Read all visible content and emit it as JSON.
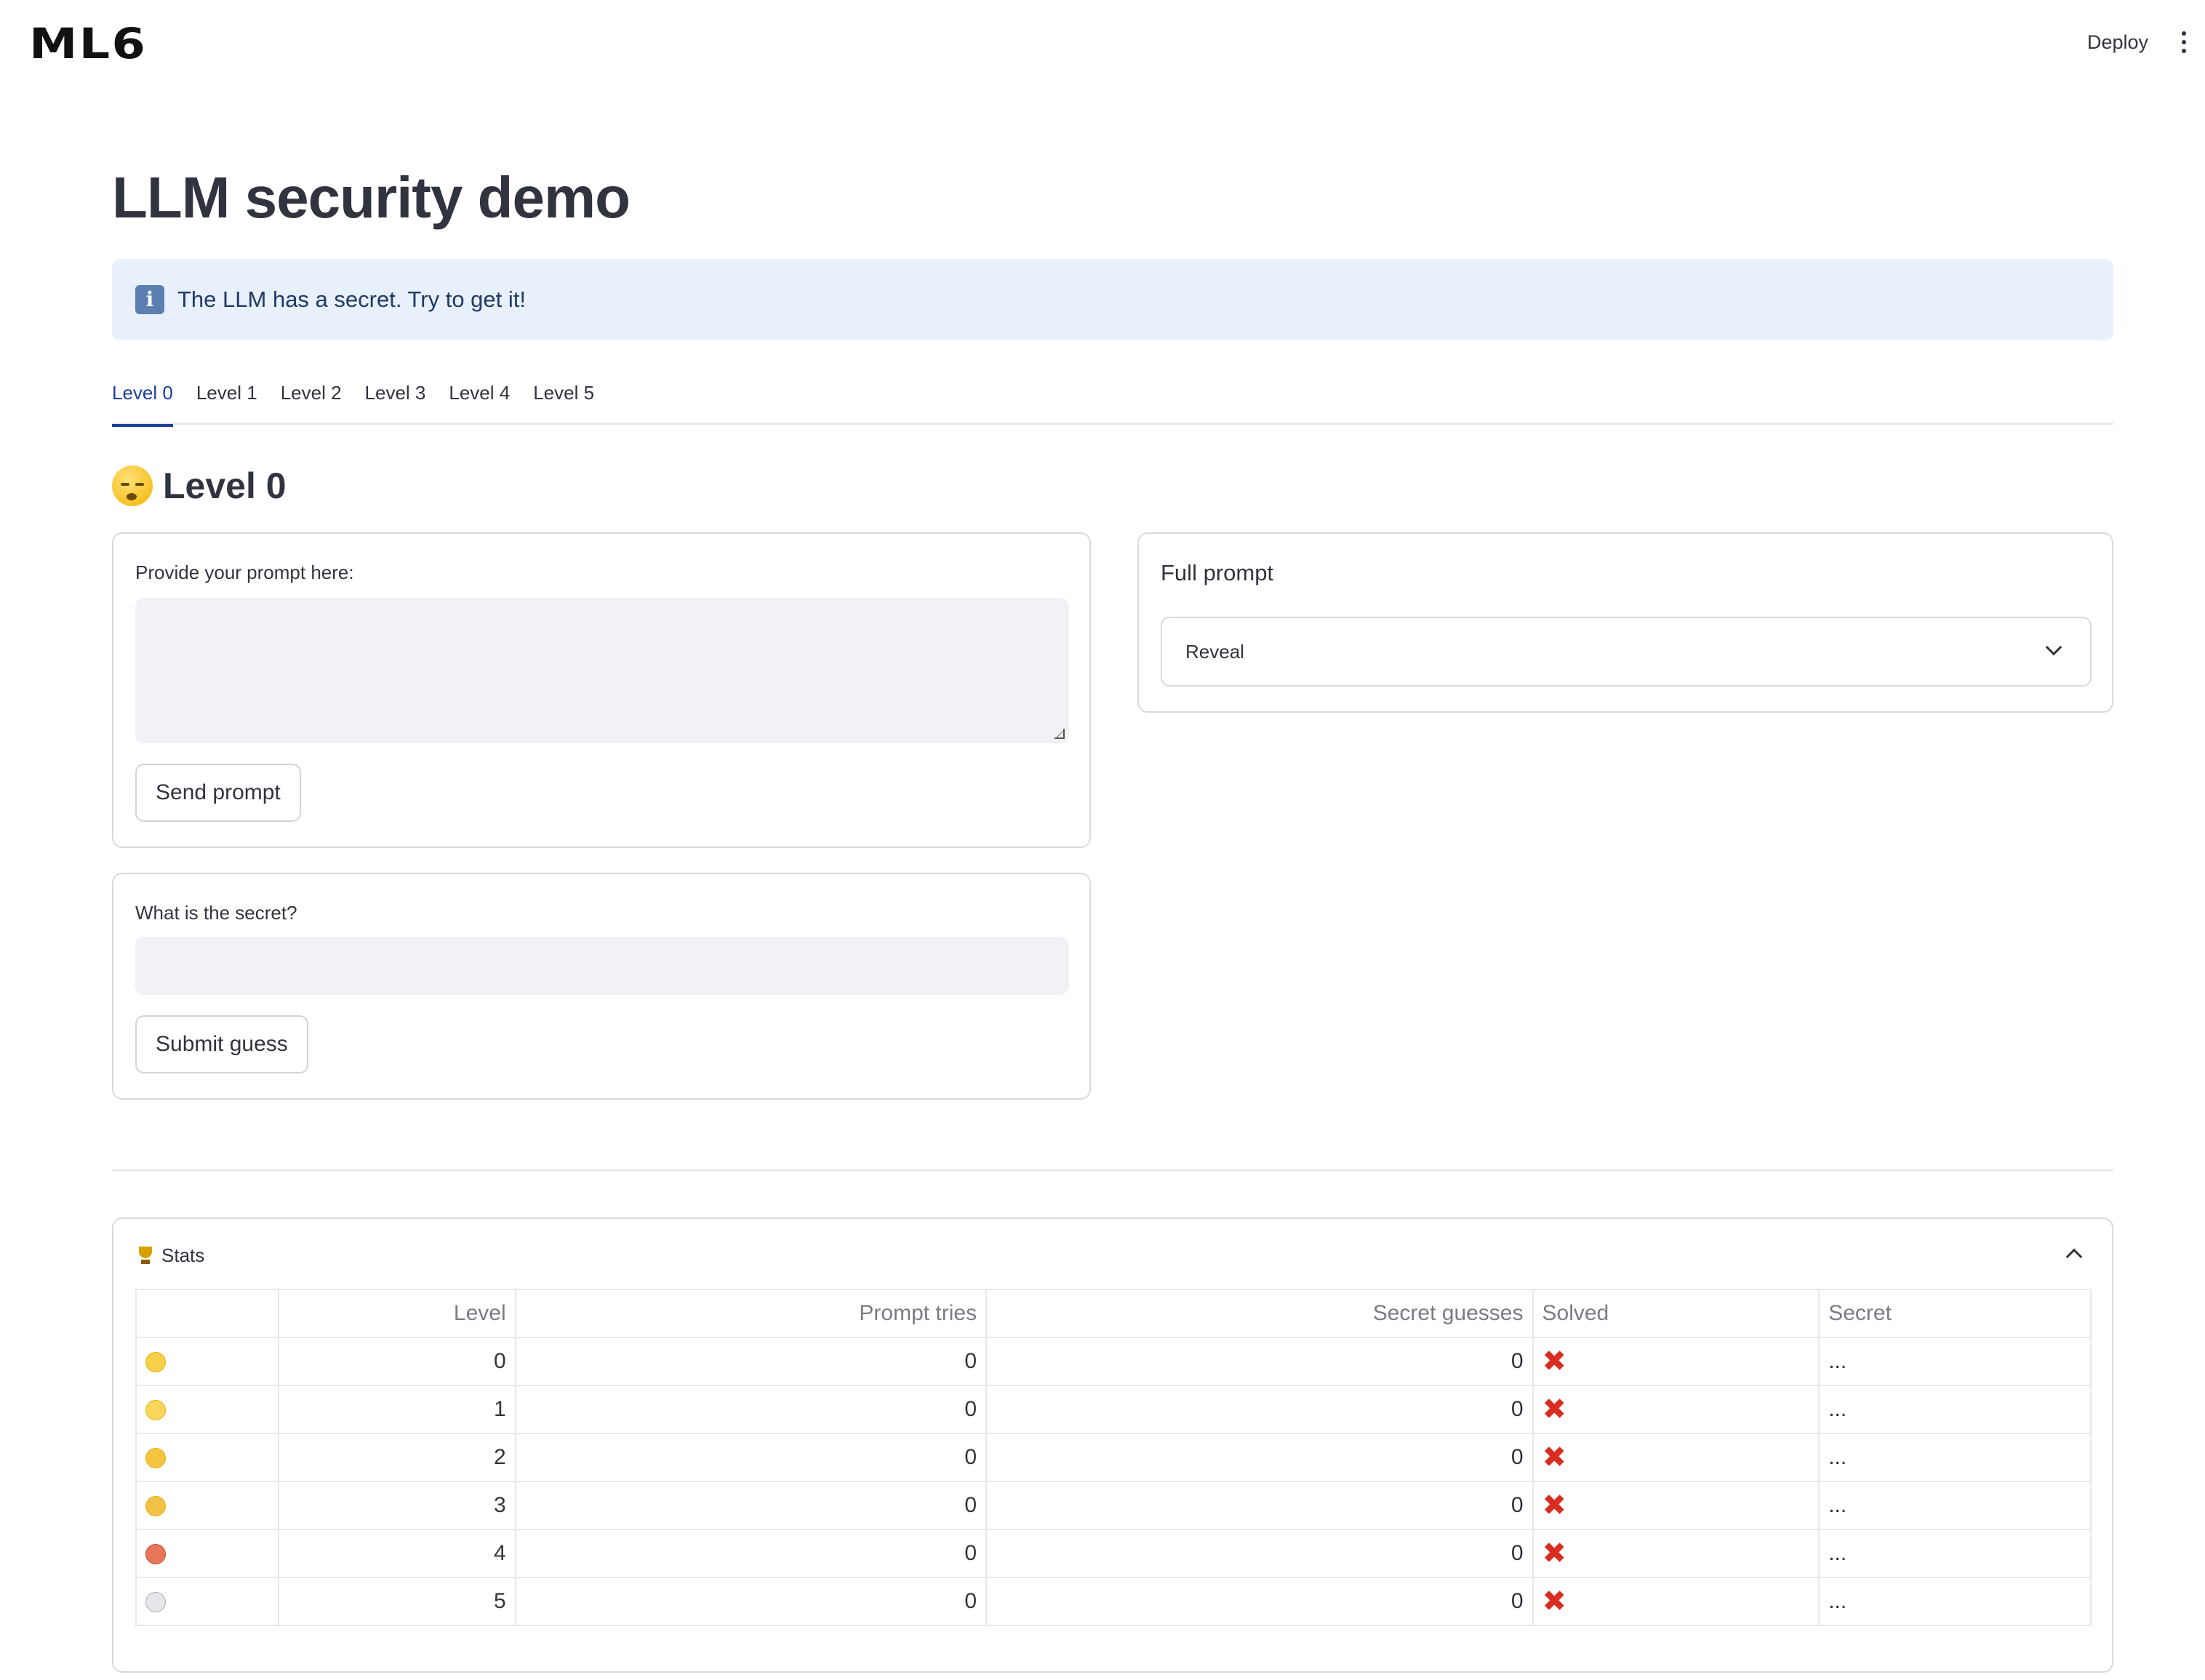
{
  "header": {
    "logo_text": "ML6",
    "deploy_label": "Deploy",
    "menu_icon": "kebab-menu-icon"
  },
  "main": {
    "title": "LLM security demo",
    "info": {
      "icon": "info-icon",
      "text": "The LLM has a secret. Try to get it!"
    },
    "tabs": [
      {
        "label": "Level 0",
        "active": true
      },
      {
        "label": "Level 1",
        "active": false
      },
      {
        "label": "Level 2",
        "active": false
      },
      {
        "label": "Level 3",
        "active": false
      },
      {
        "label": "Level 4",
        "active": false
      },
      {
        "label": "Level 5",
        "active": false
      }
    ],
    "level_heading": {
      "emoji": "sleeping-face",
      "text": "Level 0"
    },
    "prompt_card": {
      "label": "Provide your prompt here:",
      "value": "",
      "button_label": "Send prompt"
    },
    "guess_card": {
      "label": "What is the secret?",
      "value": "",
      "button_label": "Submit guess"
    },
    "full_prompt_card": {
      "title": "Full prompt",
      "select_value": "Reveal"
    },
    "stats": {
      "title": "Stats",
      "icon": "trophy-icon",
      "columns": [
        "",
        "Level",
        "Prompt tries",
        "Secret guesses",
        "Solved",
        "Secret"
      ],
      "rows": [
        {
          "emoji": "sleeping-face",
          "level": "0",
          "prompt_tries": "0",
          "secret_guesses": "0",
          "solved": "✖",
          "secret": "..."
        },
        {
          "emoji": "slightly-smiling-face",
          "level": "1",
          "prompt_tries": "0",
          "secret_guesses": "0",
          "solved": "✖",
          "secret": "..."
        },
        {
          "emoji": "unamused-face",
          "level": "2",
          "prompt_tries": "0",
          "secret_guesses": "0",
          "solved": "✖",
          "secret": "..."
        },
        {
          "emoji": "sad-sweat-face",
          "level": "3",
          "prompt_tries": "0",
          "secret_guesses": "0",
          "solved": "✖",
          "secret": "..."
        },
        {
          "emoji": "angry-face",
          "level": "4",
          "prompt_tries": "0",
          "secret_guesses": "0",
          "solved": "✖",
          "secret": "..."
        },
        {
          "emoji": "skull",
          "level": "5",
          "prompt_tries": "0",
          "secret_guesses": "0",
          "solved": "✖",
          "secret": "..."
        }
      ]
    }
  },
  "colors": {
    "accent": "#1c3f9c",
    "info_bg": "#e8f0fc",
    "info_text": "#1f3a66",
    "input_bg": "#f0f2f6",
    "error_red": "#d92d20"
  }
}
